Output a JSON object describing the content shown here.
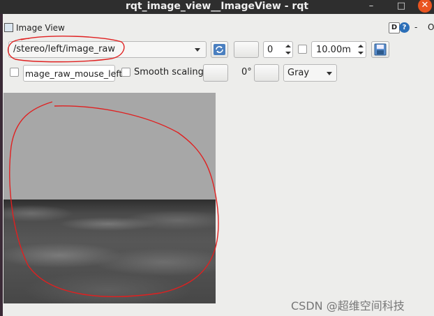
{
  "window": {
    "title": "rqt_image_view__ImageView - rqt",
    "minimize_glyph": "–",
    "maximize_glyph": "□",
    "close_glyph": "✕"
  },
  "dock": {
    "title": "Image View",
    "d_label": "D",
    "help_label": "?",
    "minimize_label": "-",
    "close_label": "O"
  },
  "toolbar": {
    "topic": "/stereo/left/image_raw",
    "spin_value": "0",
    "spin_checked": false,
    "rate_value": "10.00m",
    "mouse_checked": false,
    "mouse_topic": "mage_raw_mouse_left",
    "smooth_checked": false,
    "smooth_label": "Smooth scaling",
    "rotation_label": "0°",
    "color_scheme": "Gray"
  },
  "icons": {
    "refresh": "refresh-icon",
    "save": "save-icon",
    "rotate_left": "rotate-left-icon",
    "rotate_right": "rotate-right-icon"
  },
  "watermark": "CSDN @超维空间科技",
  "colors": {
    "titlebar_bg": "#2e2e2e",
    "close_accent": "#e95420",
    "annotation": "#e02020"
  }
}
